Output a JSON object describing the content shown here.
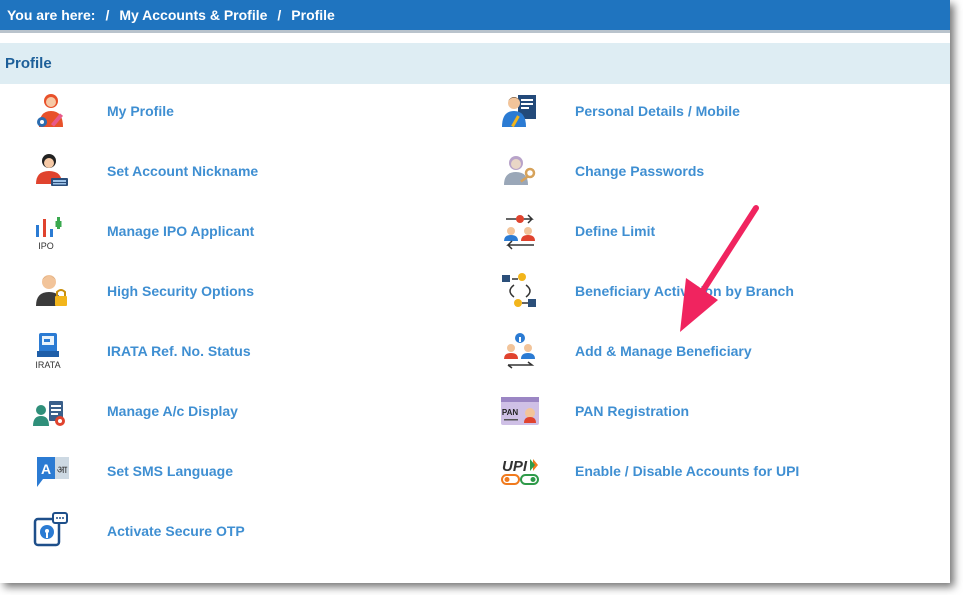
{
  "breadcrumb": {
    "prefix": "You are here:",
    "sep": "/",
    "level1": "My Accounts & Profile",
    "level2": "Profile"
  },
  "panel": {
    "title": "Profile"
  },
  "left_items": [
    {
      "label": "My Profile",
      "icon": "user-gear-icon"
    },
    {
      "label": "Set Account Nickname",
      "icon": "user-keyboard-icon"
    },
    {
      "label": "Manage IPO Applicant",
      "icon": "ipo-chart-icon",
      "icon_text": "IPO"
    },
    {
      "label": "High Security Options",
      "icon": "user-lock-icon"
    },
    {
      "label": "IRATA Ref. No. Status",
      "icon": "irata-icon",
      "icon_text": "IRATA"
    },
    {
      "label": "Manage A/c Display",
      "icon": "users-clipboard-icon"
    },
    {
      "label": "Set SMS Language",
      "icon": "language-icon",
      "icon_text_a": "A",
      "icon_text_b": "आ"
    },
    {
      "label": "Activate Secure OTP",
      "icon": "secure-otp-icon"
    }
  ],
  "right_items": [
    {
      "label": "Personal Details / Mobile",
      "icon": "user-document-icon"
    },
    {
      "label": "Change Passwords",
      "icon": "user-key-icon"
    },
    {
      "label": "Define Limit",
      "icon": "define-limit-icon"
    },
    {
      "label": "Beneficiary Activation by Branch",
      "icon": "beneficiary-activation-icon"
    },
    {
      "label": "Add & Manage Beneficiary",
      "icon": "add-beneficiary-icon"
    },
    {
      "label": "PAN Registration",
      "icon": "pan-card-icon",
      "icon_text": "PAN"
    },
    {
      "label": "Enable / Disable Accounts for UPI",
      "icon": "upi-toggle-icon",
      "icon_text": "UPI"
    }
  ],
  "colors": {
    "breadcrumb_bg": "#1f74bf",
    "panel_bg": "#deedf3",
    "panel_title": "#1d5f99",
    "link": "#3f8fd2",
    "annotation_arrow": "#f0245f"
  }
}
